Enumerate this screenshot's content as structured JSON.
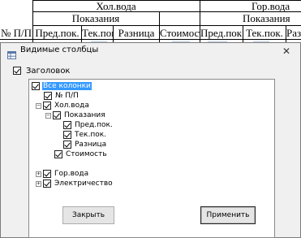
{
  "sheet": {
    "header_row1": [
      "Хол.вода",
      "Гор.вода"
    ],
    "header_row2": [
      "Показания",
      "Показания"
    ],
    "header_row3": [
      "№ П/П",
      "Пред.пок.",
      "Тек.пок.",
      "Разница",
      "Стоимость",
      "Пред.пок.",
      "Тек.пок.",
      "Разн"
    ]
  },
  "dialog": {
    "title": "Видимые столбцы",
    "close_glyph": "✕",
    "header_checkbox_label": "Заголовок",
    "tree": {
      "root": "Все колонки",
      "items": [
        "№ П/П",
        "Хол.вода",
        "Показания",
        "Пред.пок.",
        "Тек.пок.",
        "Разница",
        "Стоимость",
        "Гор.вода",
        "Электричество"
      ]
    },
    "buttons": {
      "close": "Закрыть",
      "apply": "Применить"
    }
  }
}
